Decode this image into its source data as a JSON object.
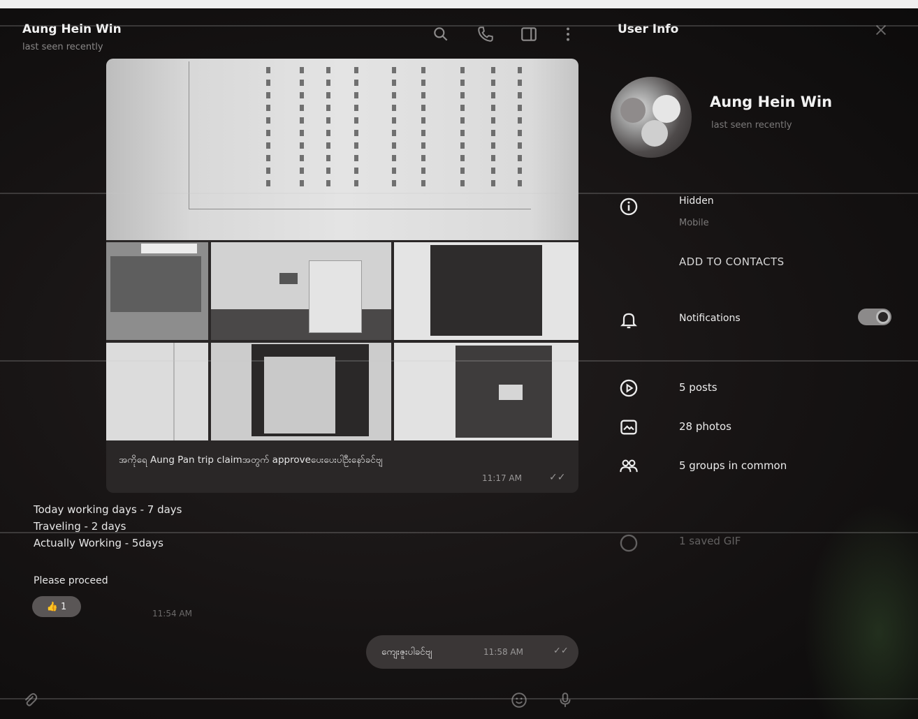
{
  "chat": {
    "name": "Aung Hein Win",
    "status": "last seen recently",
    "album_caption": "အကိုရေ Aung Pan trip claimအတွက် approveပေးပေးပါဦးနော်ခင်ဗျ",
    "album_time": "11:17 AM",
    "messages": [
      "Today working days - 7 days",
      "Traveling - 2 days",
      "Actually Working - 5days"
    ],
    "proceed_message": "Please proceed",
    "reaction_count": "1",
    "proceed_time": "11:54 AM",
    "reply_text": "ကျေးဇူးပါခင်ဗျ",
    "reply_time": "11:58 AM",
    "read_mark": "✓✓"
  },
  "info": {
    "title": "User Info",
    "close_glyph": "×",
    "profile_name": "Aung Hein Win",
    "profile_status": "last seen recently",
    "phone_label": "Hidden",
    "phone_sub": "Mobile",
    "add_contacts": "ADD TO CONTACTS",
    "notifications": "Notifications",
    "notifications_on": true,
    "posts": "5 posts",
    "photos": "28 photos",
    "groups": "5 groups in common",
    "faded_row": "1 saved GIF"
  },
  "icons": {
    "header": [
      "search-icon",
      "phone-icon",
      "sidebar-icon",
      "more-icon"
    ],
    "rows": [
      "info-icon",
      "bell-icon",
      "posts-icon",
      "photo-icon",
      "group-icon",
      "gif-icon"
    ],
    "composer": [
      "attach-icon",
      "emoji-icon",
      "microphone-icon"
    ]
  }
}
